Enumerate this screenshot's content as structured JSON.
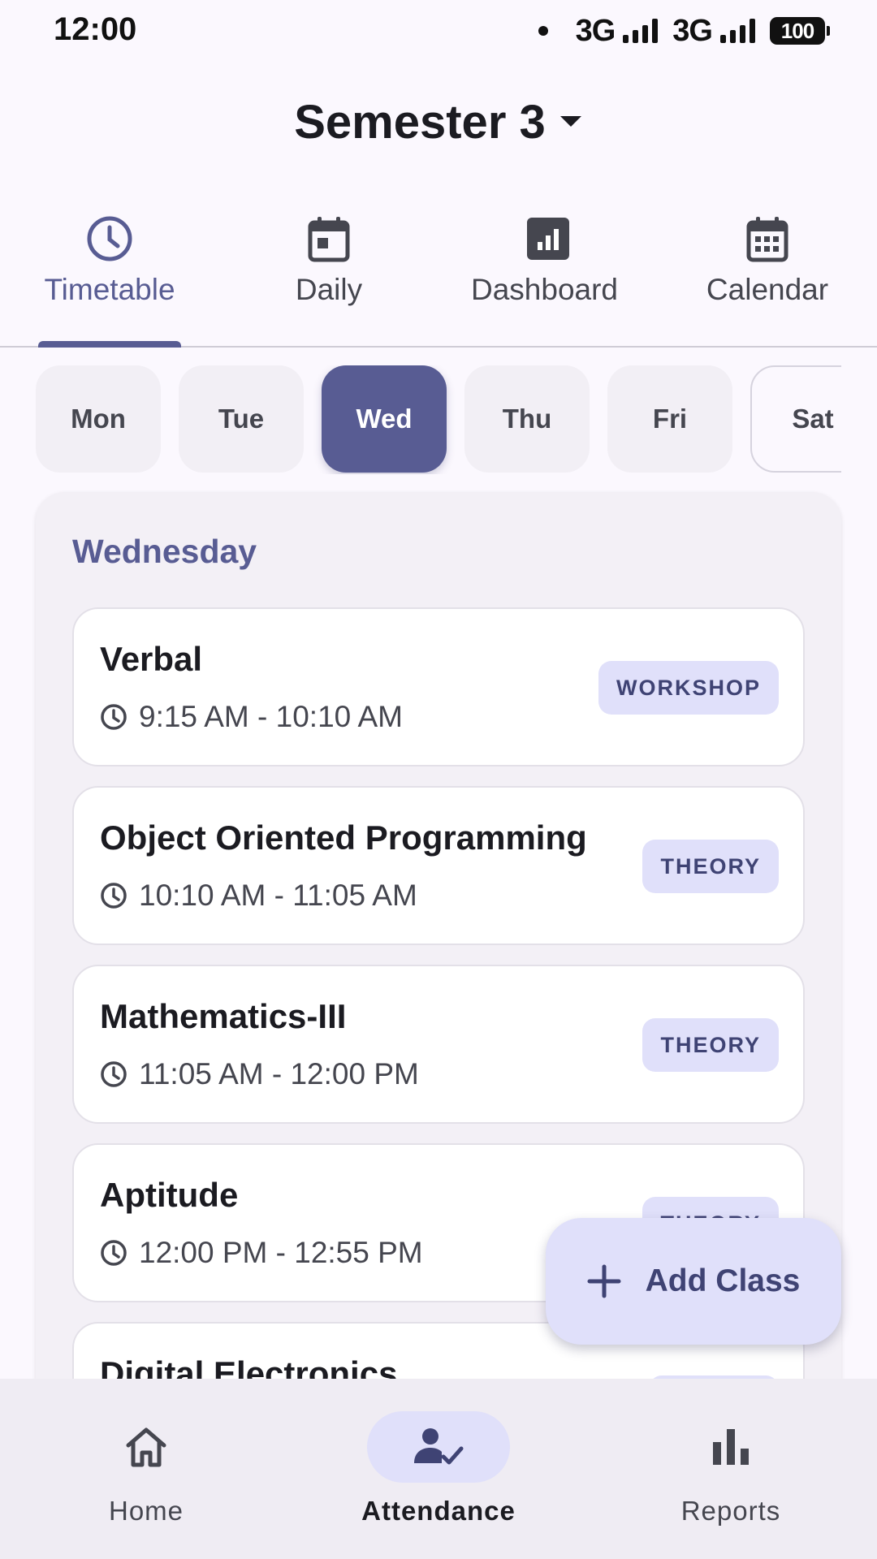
{
  "status_bar": {
    "time": "12:00",
    "network_1": "3G",
    "network_2": "3G",
    "battery": "100"
  },
  "header": {
    "title": "Semester 3"
  },
  "tabs": [
    {
      "label": "Timetable",
      "icon": "clock-icon",
      "active": true
    },
    {
      "label": "Daily",
      "icon": "calendar-day-icon",
      "active": false
    },
    {
      "label": "Dashboard",
      "icon": "bar-chart-icon",
      "active": false
    },
    {
      "label": "Calendar",
      "icon": "calendar-month-icon",
      "active": false
    }
  ],
  "days": [
    {
      "label": "Mon",
      "active": false
    },
    {
      "label": "Tue",
      "active": false
    },
    {
      "label": "Wed",
      "active": true
    },
    {
      "label": "Thu",
      "active": false
    },
    {
      "label": "Fri",
      "active": false
    },
    {
      "label": "Sat",
      "active": false
    }
  ],
  "schedule": {
    "day_title": "Wednesday",
    "classes": [
      {
        "name": "Verbal",
        "time": "9:15 AM - 10:10 AM",
        "type": "WORKSHOP"
      },
      {
        "name": "Object Oriented Programming",
        "time": "10:10 AM - 11:05 AM",
        "type": "THEORY"
      },
      {
        "name": "Mathematics-III",
        "time": "11:05 AM - 12:00 PM",
        "type": "THEORY"
      },
      {
        "name": "Aptitude",
        "time": "12:00 PM - 12:55 PM",
        "type": "THEORY"
      },
      {
        "name": "Digital Electronics",
        "time": "",
        "type": ""
      }
    ]
  },
  "fab": {
    "label": "Add Class",
    "icon": "plus-icon"
  },
  "bottom_nav": [
    {
      "label": "Home",
      "icon": "home-icon",
      "active": false
    },
    {
      "label": "Attendance",
      "icon": "person-check-icon",
      "active": true
    },
    {
      "label": "Reports",
      "icon": "bar-chart-icon",
      "active": false
    }
  ],
  "colors": {
    "primary": "#585C93",
    "badge_bg": "#E0E0FA",
    "surface": "#FBF8FE"
  }
}
